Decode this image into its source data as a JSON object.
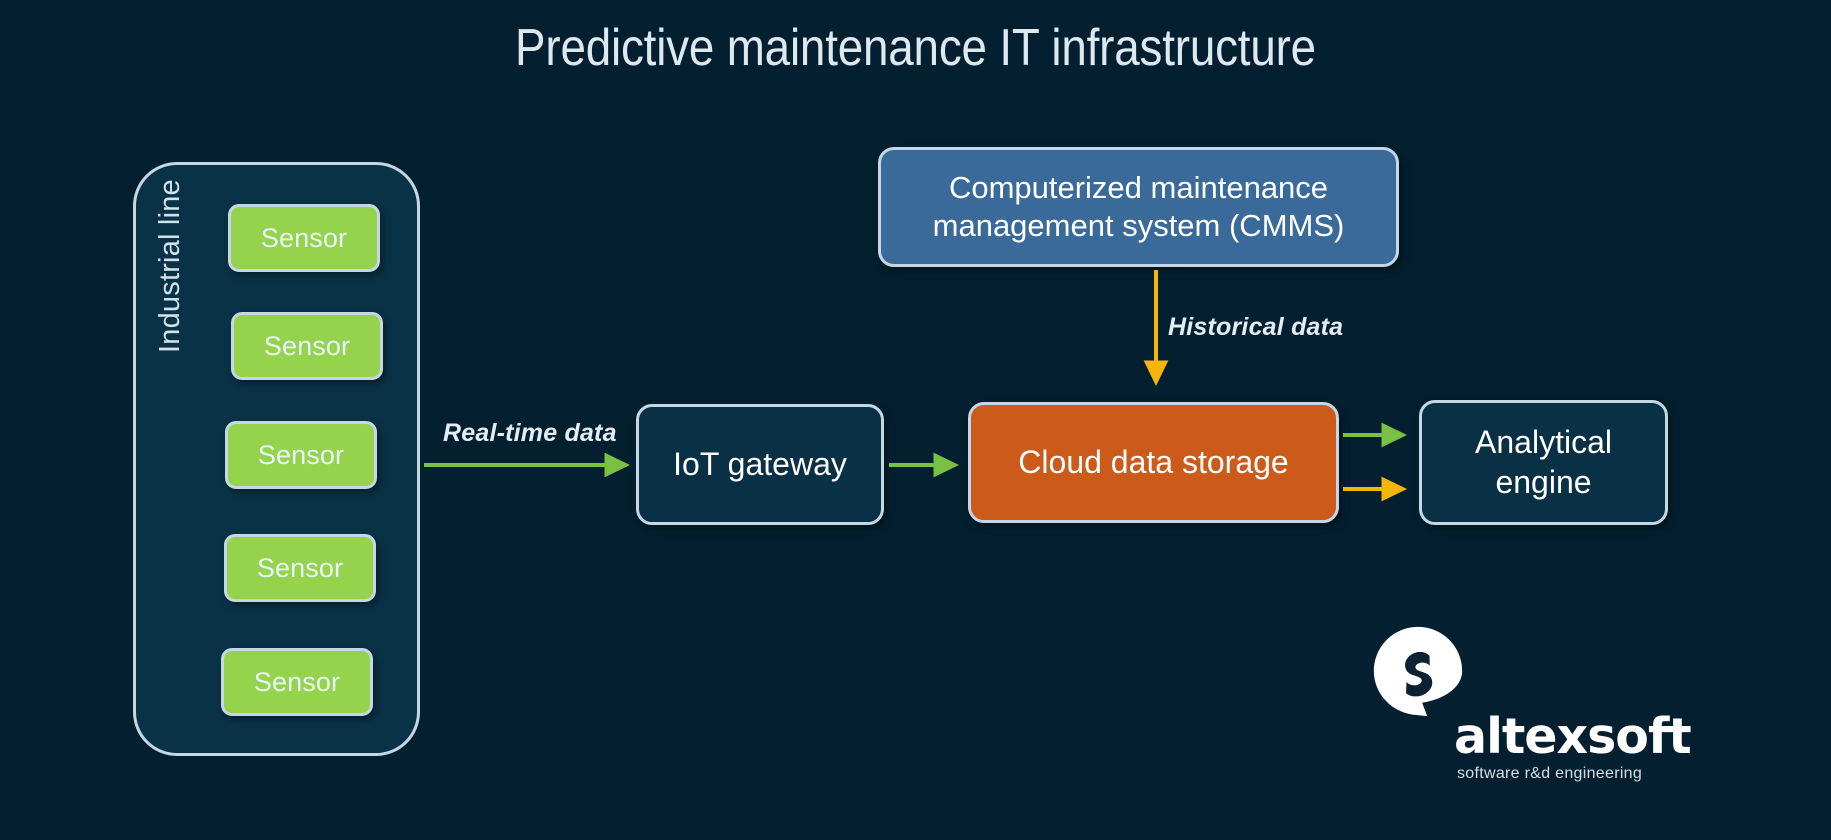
{
  "page": {
    "title": "Predictive maintenance IT infrastructure",
    "background_color": "#042030"
  },
  "colors": {
    "background": "#042030",
    "panel_fill": "#0a3246",
    "node_border": "#c5d7e4",
    "sensor_green": "#96d34d",
    "cmms_blue": "#3a6a99",
    "cloud_orange": "#cb5a1b",
    "dark_node_fill": "#093044",
    "arrow_green": "#7ac143",
    "arrow_yellow": "#f5b50a",
    "text_light": "#e9f4f9"
  },
  "industrial_line": {
    "label": "Industrial line",
    "sensors": [
      {
        "label": "Sensor"
      },
      {
        "label": "Sensor"
      },
      {
        "label": "Sensor"
      },
      {
        "label": "Sensor"
      },
      {
        "label": "Sensor"
      }
    ]
  },
  "nodes": {
    "cmms": {
      "line1": "Computerized maintenance",
      "line2": "management system (CMMS)"
    },
    "iot_gateway": {
      "label": "IoT gateway"
    },
    "cloud_storage": {
      "label": "Cloud data storage"
    },
    "analytical_engine": {
      "line1": "Analytical",
      "line2": "engine"
    }
  },
  "edges": [
    {
      "id": "sensors-to-iot",
      "label": "Real-time data",
      "color": "#7ac143"
    },
    {
      "id": "iot-to-cloud",
      "label": "",
      "color": "#7ac143"
    },
    {
      "id": "cmms-to-cloud",
      "label": "Historical data",
      "color": "#f5b50a"
    },
    {
      "id": "cloud-to-analytical-green",
      "label": "",
      "color": "#7ac143"
    },
    {
      "id": "cloud-to-analytical-yellow",
      "label": "",
      "color": "#f5b50a"
    }
  ],
  "logo": {
    "wordmark": "altexsoft",
    "tagline": "software r&d engineering"
  }
}
